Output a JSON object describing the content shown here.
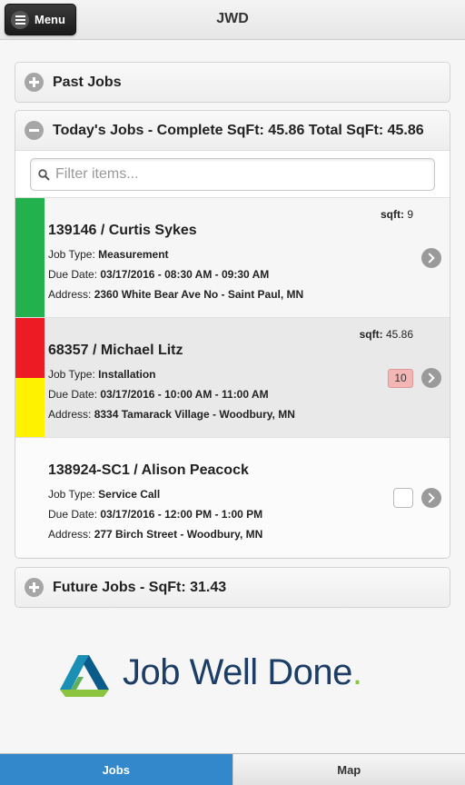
{
  "header": {
    "title": "JWD",
    "menu_label": "Menu"
  },
  "past_jobs": {
    "label": "Past Jobs"
  },
  "todays_jobs": {
    "label": "Today's Jobs - Complete SqFt: 45.86 Total SqFt: 45.86",
    "filter_placeholder": "Filter items...",
    "field_labels": {
      "job_type": "Job Type:",
      "due_date": "Due Date:",
      "address": "Address:",
      "sqft": "sqft:"
    },
    "jobs": [
      {
        "title": "139146 / Curtis Sykes",
        "sqft": "9",
        "job_type": "Measurement",
        "due_date": "03/17/2016 - 08:30 AM - 09:30 AM",
        "address": "2360 White Bear Ave No - Saint Paul, MN",
        "status_colors": [
          "#22b14c"
        ]
      },
      {
        "title": "68357 / Michael Litz",
        "sqft": "45.86",
        "job_type": "Installation",
        "due_date": "03/17/2016 - 10:00 AM - 11:00 AM",
        "address": "8334 Tamarack Village - Woodbury, MN",
        "badge": "10",
        "status_colors": [
          "#ed1c24",
          "#fff200"
        ]
      },
      {
        "title": "138924-SC1 / Alison Peacock",
        "job_type": "Service Call",
        "due_date": "03/17/2016 - 12:00 PM - 1:00 PM",
        "address": "277 Birch Street - Woodbury, MN",
        "checked": false,
        "status_colors": []
      }
    ]
  },
  "future_jobs": {
    "label": "Future Jobs - SqFt: 31.43"
  },
  "logo": {
    "text": "Job Well Done",
    "dot": "."
  },
  "footer": {
    "tabs": [
      {
        "label": "Jobs",
        "active": true
      },
      {
        "label": "Map",
        "active": false
      }
    ]
  },
  "colors": {
    "accent": "#3388cc",
    "logo_navy": "#1c3e66",
    "logo_green": "#8bc53f"
  }
}
